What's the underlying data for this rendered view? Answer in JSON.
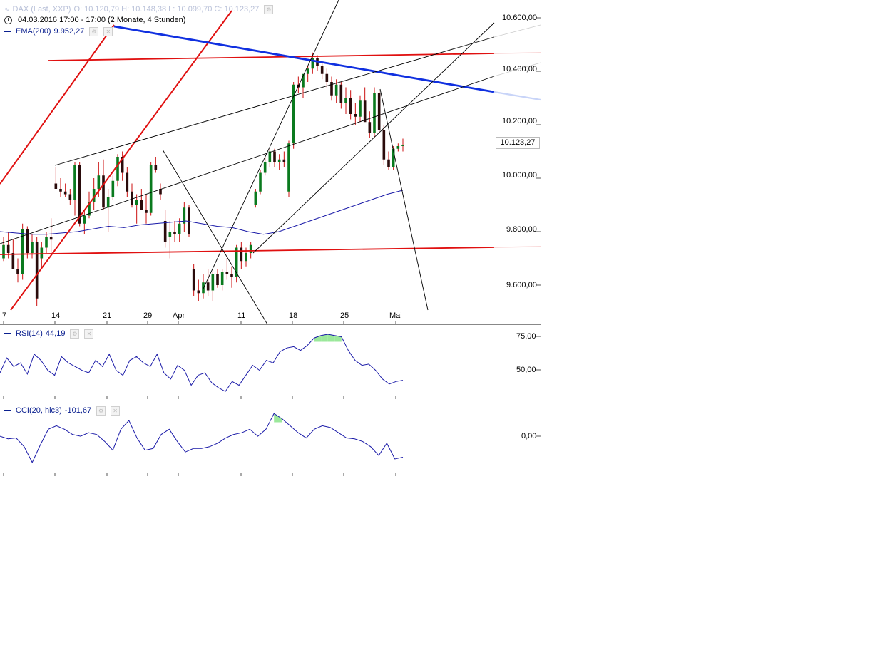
{
  "header": {
    "title_faded": "DAX (Last, XXP)",
    "ohlc": "O: 10.120,79  H: 10.148,38  L: 10.099,70  C: 10.123,27",
    "period": "04.03.2016 17:00 - 17:00 (2 Monate, 4 Stunden)",
    "ema_label": "EMA(200)",
    "ema_value": "9.952,27"
  },
  "price_axis": {
    "ticks": [
      "10.600,00",
      "10.400,00",
      "10.200,00",
      "10.000,00",
      "9.800,00",
      "9.600,00"
    ],
    "last_price": "10.123,27"
  },
  "time_axis": {
    "ticks": [
      "7",
      "14",
      "21",
      "29",
      "Apr",
      "11",
      "18",
      "25",
      "Mai"
    ]
  },
  "rsi": {
    "label": "RSI(14)",
    "value": "44,19",
    "ticks": [
      "75,00",
      "50,00"
    ]
  },
  "cci": {
    "label": "CCI(20, hlc3)",
    "value": "-101,67",
    "ticks": [
      "0,00"
    ]
  },
  "colors": {
    "bull": "#0a7a1e",
    "bear": "#2a0b0b",
    "wick": "#cc1111",
    "ema": "#1a1aa8",
    "blue_trend": "#1030e0",
    "red_trend": "#e01010",
    "rsi_fill": "#9be89b",
    "cci_neg_fill": "#f0a0a8"
  },
  "chart_data": {
    "type": "candlestick",
    "series_name": "DAX",
    "x_ticks": [
      "7",
      "14",
      "21",
      "29",
      "Apr",
      "11",
      "18",
      "25",
      "Mai"
    ],
    "ylim": [
      9500,
      10650
    ],
    "candles": [
      [
        9700,
        9780,
        9690,
        9750
      ],
      [
        9750,
        9800,
        9700,
        9720
      ],
      [
        9720,
        9770,
        9680,
        9660
      ],
      [
        9660,
        9700,
        9610,
        9640
      ],
      [
        9640,
        9830,
        9620,
        9810
      ],
      [
        9810,
        9820,
        9700,
        9720
      ],
      [
        9720,
        9790,
        9700,
        9760
      ],
      [
        9760,
        9780,
        9520,
        9550
      ],
      [
        9700,
        9760,
        9660,
        9740
      ],
      [
        9740,
        9800,
        9720,
        9780
      ],
      [
        9780,
        9850,
        9720,
        9770
      ],
      [
        9980,
        10040,
        9960,
        9960
      ],
      [
        9960,
        10000,
        9930,
        9950
      ],
      [
        9950,
        9980,
        9930,
        9940
      ],
      [
        9940,
        9960,
        9900,
        9920
      ],
      [
        9920,
        10060,
        9860,
        10050
      ],
      [
        10050,
        10060,
        9820,
        9830
      ],
      [
        9830,
        9880,
        9790,
        9860
      ],
      [
        9860,
        9950,
        9850,
        9910
      ],
      [
        9910,
        10000,
        9880,
        9960
      ],
      [
        9960,
        10060,
        9930,
        10010
      ],
      [
        10010,
        10070,
        9880,
        9890
      ],
      [
        9890,
        9960,
        9800,
        9930
      ],
      [
        9930,
        10010,
        9920,
        9990
      ],
      [
        9990,
        10090,
        9970,
        10080
      ],
      [
        10080,
        10100,
        9990,
        10020
      ],
      [
        10020,
        10040,
        9930,
        9950
      ],
      [
        9950,
        9980,
        9890,
        9900
      ],
      [
        9900,
        9940,
        9830,
        9920
      ],
      [
        9920,
        9960,
        9890,
        9880
      ],
      [
        9880,
        9940,
        9830,
        9870
      ],
      [
        9870,
        10060,
        9860,
        10050
      ],
      [
        10050,
        10080,
        10020,
        10030
      ],
      [
        9960,
        9980,
        9920,
        9940
      ],
      [
        9840,
        9880,
        9740,
        9760
      ],
      [
        9780,
        9840,
        9700,
        9800
      ],
      [
        9800,
        9840,
        9760,
        9790
      ],
      [
        9790,
        9850,
        9760,
        9830
      ],
      [
        9830,
        9910,
        9800,
        9890
      ],
      [
        9890,
        9900,
        9780,
        9790
      ],
      [
        9660,
        9680,
        9560,
        9580
      ],
      [
        9580,
        9620,
        9540,
        9570
      ],
      [
        9570,
        9640,
        9550,
        9610
      ],
      [
        9610,
        9660,
        9560,
        9580
      ],
      [
        9580,
        9650,
        9540,
        9640
      ],
      [
        9640,
        9660,
        9590,
        9600
      ],
      [
        9600,
        9660,
        9580,
        9650
      ],
      [
        9650,
        9700,
        9620,
        9640
      ],
      [
        9640,
        9670,
        9590,
        9630
      ],
      [
        9630,
        9750,
        9610,
        9740
      ],
      [
        9740,
        9760,
        9660,
        9690
      ],
      [
        9690,
        9740,
        9670,
        9720
      ],
      [
        9720,
        9760,
        9700,
        9750
      ],
      [
        9900,
        9960,
        9890,
        9950
      ],
      [
        9950,
        10030,
        9940,
        10020
      ],
      [
        10020,
        10080,
        10010,
        10060
      ],
      [
        10060,
        10110,
        10040,
        10100
      ],
      [
        10100,
        10110,
        10040,
        10060
      ],
      [
        10060,
        10090,
        10030,
        10070
      ],
      [
        10070,
        10100,
        10040,
        10060
      ],
      [
        9950,
        10140,
        9930,
        10130
      ],
      [
        10130,
        10360,
        10110,
        10350
      ],
      [
        10350,
        10380,
        10320,
        10340
      ],
      [
        10340,
        10380,
        10300,
        10390
      ],
      [
        10390,
        10420,
        10360,
        10410
      ],
      [
        10410,
        10470,
        10390,
        10450
      ],
      [
        10450,
        10460,
        10400,
        10420
      ],
      [
        10420,
        10440,
        10370,
        10390
      ],
      [
        10390,
        10410,
        10340,
        10360
      ],
      [
        10360,
        10380,
        10290,
        10310
      ],
      [
        10310,
        10370,
        10280,
        10350
      ],
      [
        10350,
        10360,
        10260,
        10280
      ],
      [
        10280,
        10340,
        10240,
        10300
      ],
      [
        10300,
        10330,
        10220,
        10240
      ],
      [
        10240,
        10280,
        10200,
        10230
      ],
      [
        10230,
        10310,
        10210,
        10290
      ],
      [
        10290,
        10340,
        10260,
        10210
      ],
      [
        10210,
        10250,
        10150,
        10170
      ],
      [
        10170,
        10340,
        10150,
        10320
      ],
      [
        10320,
        10330,
        10170,
        10180
      ],
      [
        10180,
        10200,
        10050,
        10070
      ],
      [
        10070,
        10100,
        10030,
        10040
      ],
      [
        10040,
        10120,
        10030,
        10110
      ],
      [
        10110,
        10130,
        10100,
        10120
      ],
      [
        10120,
        10148,
        10100,
        10123
      ]
    ],
    "ema200": [
      9800,
      9795,
      9790,
      9790,
      9795,
      9800,
      9810,
      9820,
      9815,
      9825,
      9830,
      9835,
      9840,
      9830,
      9820,
      9815,
      9800,
      9790,
      9800,
      9820,
      9840,
      9860,
      9880,
      9900,
      9920,
      9940,
      9955
    ],
    "rsi_range": [
      30,
      85
    ],
    "rsi_values": [
      50,
      62,
      55,
      58,
      49,
      65,
      60,
      52,
      48,
      63,
      58,
      55,
      52,
      50,
      60,
      55,
      65,
      52,
      48,
      60,
      63,
      58,
      55,
      65,
      50,
      45,
      56,
      52,
      40,
      48,
      50,
      42,
      38,
      35,
      43,
      40,
      48,
      56,
      52,
      60,
      58,
      67,
      70,
      71,
      68,
      72,
      78,
      80,
      81,
      80,
      79,
      68,
      60,
      56,
      57,
      52,
      45,
      41,
      43,
      44
    ],
    "cci_range": [
      -200,
      200
    ],
    "cci_values": [
      20,
      5,
      10,
      -40,
      -130,
      -30,
      60,
      80,
      60,
      30,
      20,
      40,
      30,
      -10,
      -60,
      60,
      110,
      10,
      -60,
      -50,
      30,
      60,
      -10,
      -70,
      -50,
      -50,
      -40,
      -20,
      10,
      30,
      40,
      60,
      20,
      60,
      150,
      120,
      80,
      40,
      10,
      60,
      80,
      70,
      40,
      10,
      5,
      -10,
      -40,
      -90,
      -20,
      -110,
      -100
    ]
  }
}
